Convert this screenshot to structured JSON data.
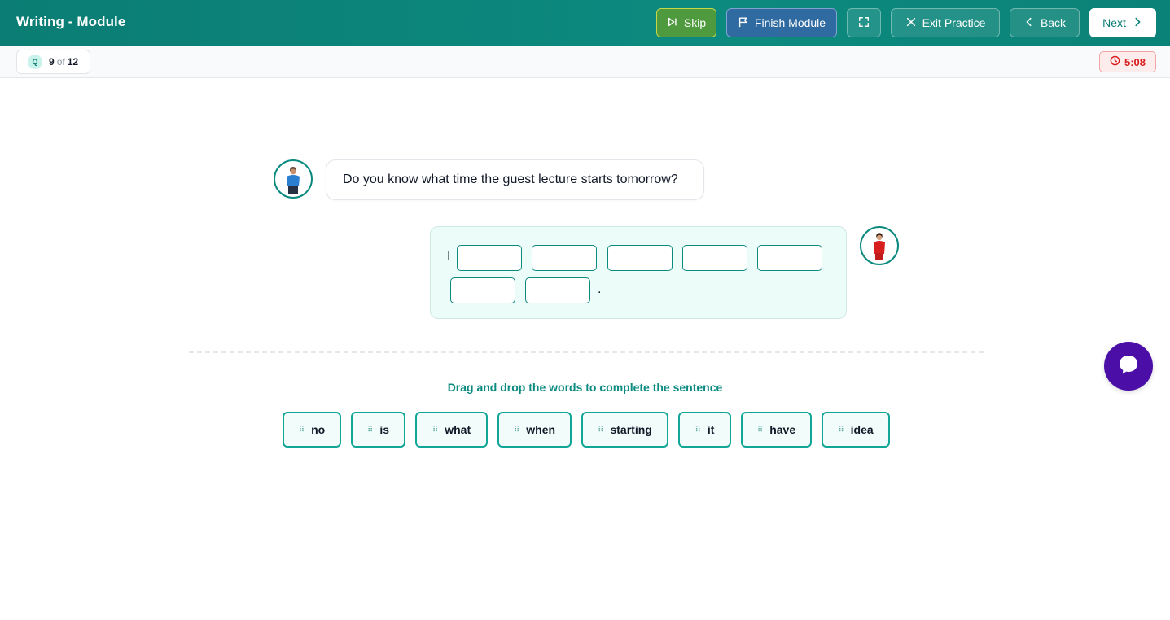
{
  "header": {
    "title": "Writing - Module",
    "skip_label": "Skip",
    "finish_label": "Finish Module",
    "exit_label": "Exit Practice",
    "back_label": "Back",
    "next_label": "Next"
  },
  "progress": {
    "badge": "Q",
    "current": "9",
    "of": "of",
    "total": "12"
  },
  "timer": {
    "value": "5:08"
  },
  "question": {
    "prompt": "Do you know what time the guest lecture starts tomorrow?"
  },
  "answer": {
    "prefix": "I",
    "suffix": ".",
    "blank_count": 7
  },
  "instruction": "Drag and drop the words to complete the sentence",
  "word_bank": [
    "no",
    "is",
    "what",
    "when",
    "starting",
    "it",
    "have",
    "idea"
  ],
  "colors": {
    "brand": "#0b7d74",
    "skip": "#4f9a3e",
    "finish": "#2f6aa0",
    "timer": "#d81b1b",
    "chat": "#4b0fa8"
  },
  "icons": {
    "skip": "skip-forward-icon",
    "finish": "flag-icon",
    "fullscreen": "fullscreen-icon",
    "exit": "close-icon",
    "back": "chevron-left-icon",
    "next": "chevron-right-icon",
    "timer": "clock-icon",
    "grip": "drag-grip-icon",
    "chat": "chat-bubble-icon"
  }
}
